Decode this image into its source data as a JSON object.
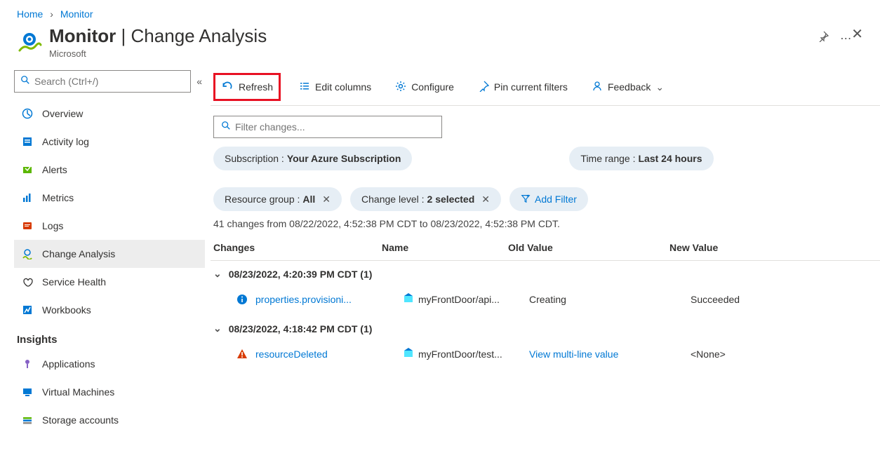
{
  "breadcrumb": {
    "home": "Home",
    "current": "Monitor"
  },
  "header": {
    "title": "Monitor",
    "subtitle": "Change Analysis",
    "publisher": "Microsoft"
  },
  "search": {
    "placeholder": "Search (Ctrl+/)"
  },
  "nav": {
    "overview": "Overview",
    "activity_log": "Activity log",
    "alerts": "Alerts",
    "metrics": "Metrics",
    "logs": "Logs",
    "change_analysis": "Change Analysis",
    "service_health": "Service Health",
    "workbooks": "Workbooks",
    "insights_header": "Insights",
    "applications": "Applications",
    "virtual_machines": "Virtual Machines",
    "storage_accounts": "Storage accounts"
  },
  "toolbar": {
    "refresh": "Refresh",
    "edit_columns": "Edit columns",
    "configure": "Configure",
    "pin": "Pin current filters",
    "feedback": "Feedback"
  },
  "filter": {
    "placeholder": "Filter changes..."
  },
  "pills": {
    "subscription_label": "Subscription :",
    "subscription_value": "Your Azure Subscription",
    "time_label": "Time range :",
    "time_value": "Last 24 hours",
    "rg_label": "Resource group :",
    "rg_value": "All",
    "level_label": "Change level :",
    "level_value": "2 selected",
    "add_filter": "Add Filter"
  },
  "summary_text": "41 changes from 08/22/2022, 4:52:38 PM CDT to 08/23/2022, 4:52:38 PM CDT.",
  "table": {
    "col_changes": "Changes",
    "col_name": "Name",
    "col_old": "Old Value",
    "col_new": "New Value",
    "group1": {
      "label": "08/23/2022, 4:20:39 PM CDT (1)"
    },
    "row1": {
      "change": "properties.provisioni...",
      "name": "myFrontDoor/api...",
      "old": "Creating",
      "new": "Succeeded"
    },
    "group2": {
      "label": "08/23/2022, 4:18:42 PM CDT (1)"
    },
    "row2": {
      "change": "resourceDeleted",
      "name": "myFrontDoor/test...",
      "old": "View multi-line value",
      "new": "<None>"
    }
  }
}
